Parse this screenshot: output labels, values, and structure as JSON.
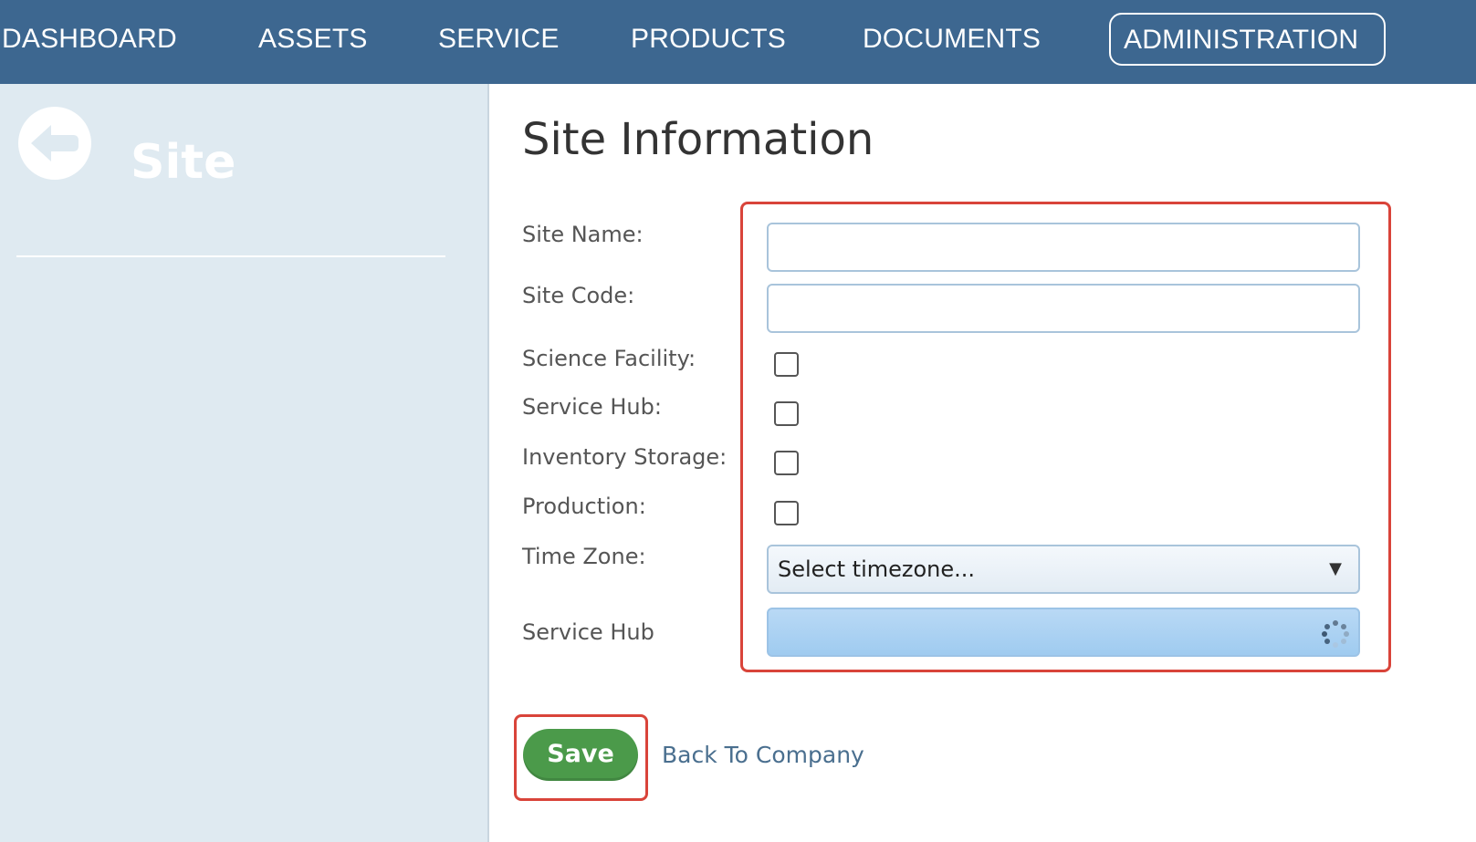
{
  "nav": {
    "items": [
      {
        "label": "DASHBOARD"
      },
      {
        "label": "ASSETS"
      },
      {
        "label": "SERVICE"
      },
      {
        "label": "PRODUCTS"
      },
      {
        "label": "DOCUMENTS"
      },
      {
        "label": "ADMINISTRATION",
        "active": true
      }
    ],
    "background": "#3d6790"
  },
  "sidebar": {
    "back_icon": "arrow-left-circle-icon",
    "title": "Site",
    "background": "#dfeaf1"
  },
  "main": {
    "heading": "Site Information",
    "form": {
      "site_name": {
        "label": "Site Name:",
        "value": ""
      },
      "site_code": {
        "label": "Site Code:",
        "value": ""
      },
      "science_facility": {
        "label": "Science Facility:",
        "checked": false
      },
      "service_hub_check": {
        "label": "Service Hub:",
        "checked": false
      },
      "inventory_storage": {
        "label": "Inventory Storage:",
        "checked": false
      },
      "production": {
        "label": "Production:",
        "checked": false
      },
      "time_zone": {
        "label": "Time Zone:",
        "selected": "Select timezone...",
        "caret_icon": "chevron-down-icon"
      },
      "service_hub_select": {
        "label": "Service Hub",
        "loading_icon": "spinner-icon"
      }
    },
    "actions": {
      "save_label": "Save",
      "back_link": "Back To Company"
    }
  },
  "colors": {
    "highlight": "#d9443a",
    "save_button": "#4b9a4a",
    "link": "#4a6f8f"
  }
}
